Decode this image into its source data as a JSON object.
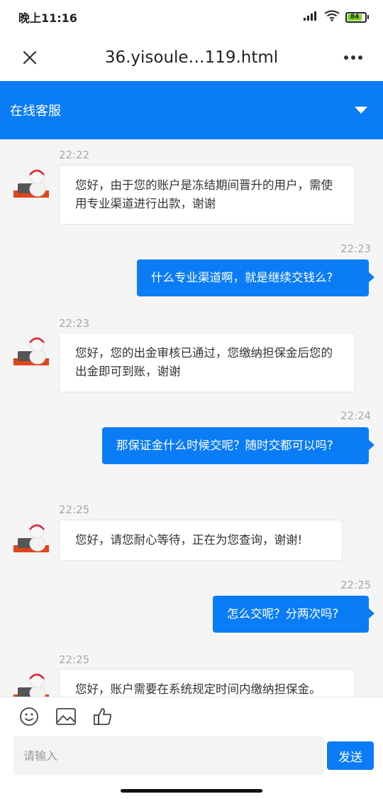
{
  "status_bar": {
    "time": "晚上11:16",
    "battery": "84",
    "icons": [
      "signal-icon",
      "wifi-icon",
      "battery-icon"
    ]
  },
  "browser": {
    "url": "36.yisoule…119.html",
    "close_icon": "close-icon",
    "more_icon": "more-icon"
  },
  "header": {
    "title": "在线客服",
    "toggle_icon": "caret-down-icon"
  },
  "messages": [
    {
      "direction": "in",
      "time": "22:22",
      "text": "您好，由于您的账户是冻结期间晋升的用户，需使用专业渠道进行出款，谢谢"
    },
    {
      "direction": "out",
      "time": "22:23",
      "text": "什么专业渠道啊，就是继续交钱么?"
    },
    {
      "direction": "in",
      "time": "22:23",
      "text": "您好，您的出金审核已通过，您缴纳担保金后您的出金即可到账，谢谢"
    },
    {
      "direction": "out",
      "time": "22:24",
      "text": "那保证金什么时候交呢？随时交都可以吗?"
    },
    {
      "direction": "in",
      "time": "22:25",
      "text": "您好，请您耐心等待，正在为您查询，谢谢!"
    },
    {
      "direction": "out",
      "time": "22:25",
      "text": "怎么交呢？分两次吗?"
    },
    {
      "direction": "in",
      "time": "22:25",
      "text": "您好，账户需要在系统规定时间内缴纳担保金。"
    }
  ],
  "input": {
    "placeholder": "请输入",
    "send_label": "发送",
    "tools": [
      "emoji-icon",
      "image-icon",
      "thumbs-up-icon"
    ]
  },
  "colors": {
    "accent": "#0a7cf6",
    "chat_bg": "#f5f5f5",
    "time_text": "#a8a8a8"
  }
}
